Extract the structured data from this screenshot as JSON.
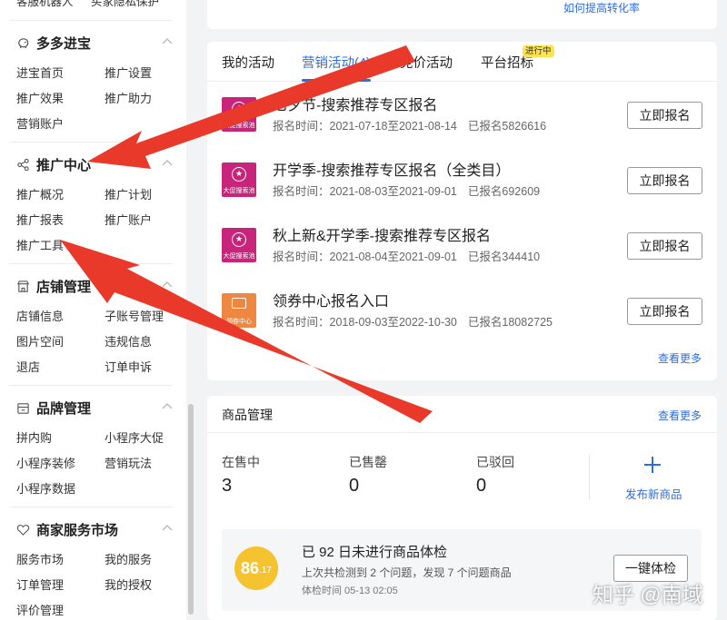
{
  "sidebar": {
    "top_items": [
      "客服机器人",
      "买家隐私保护"
    ],
    "groups": [
      {
        "title": "多多进宝",
        "icon": "pig-icon",
        "items": [
          "进宝首页",
          "推广设置",
          "推广效果",
          "推广助力",
          "营销账户"
        ]
      },
      {
        "title": "推广中心",
        "icon": "share-icon",
        "items": [
          "推广概况",
          "推广计划",
          "推广报表",
          "推广账户",
          "推广工具"
        ]
      },
      {
        "title": "店铺管理",
        "icon": "store-icon",
        "items": [
          "店铺信息",
          "子账号管理",
          "图片空间",
          "违规信息",
          "退店",
          "订单申诉"
        ]
      },
      {
        "title": "品牌管理",
        "icon": "brand-icon",
        "items": [
          "拼内购",
          "小程序大促",
          "小程序装修",
          "营销玩法",
          "小程序数据"
        ]
      },
      {
        "title": "商家服务市场",
        "icon": "heart-icon",
        "items": [
          "服务市场",
          "我的服务",
          "订单管理",
          "我的授权",
          "评价管理"
        ]
      }
    ]
  },
  "top_card": {
    "link": "如何提高转化率"
  },
  "activities": {
    "tabs": [
      "我的活动",
      "营销活动(4)",
      "竞价活动",
      "平台招标"
    ],
    "active_tab": 1,
    "badge": "进行中",
    "rows": [
      {
        "title": "七夕节-搜索推荐专区报名",
        "time": "报名时间：2021-07-18至2021-08-14",
        "count": "已报名5826616",
        "thumb_label": "大促搜索池",
        "button": "立即报名"
      },
      {
        "title": "开学季-搜索推荐专区报名（全类目）",
        "time": "报名时间：2021-08-03至2021-09-01",
        "count": "已报名692609",
        "thumb_label": "大促搜索池",
        "button": "立即报名"
      },
      {
        "title": "秋上新&开学季-搜索推荐专区报名",
        "time": "报名时间：2021-08-04至2021-09-01",
        "count": "已报名344410",
        "thumb_label": "大促搜索池",
        "button": "立即报名"
      },
      {
        "title": "领券中心报名入口",
        "time": "报名时间：2018-09-03至2022-10-30",
        "count": "已报名18082725",
        "thumb_label": "领券中心",
        "button": "立即报名"
      }
    ],
    "more": "查看更多"
  },
  "goods": {
    "title": "商品管理",
    "more": "查看更多",
    "stats": [
      {
        "label": "在售中",
        "value": "3"
      },
      {
        "label": "已售罄",
        "value": "0"
      },
      {
        "label": "已驳回",
        "value": "0"
      }
    ],
    "publish": "发布新商品",
    "health": {
      "score_int": "86",
      "score_dec": ".17",
      "title": "已 92 日未进行商品体检",
      "desc": "上次共检测到 2 个问题，发现 7 个问题商品",
      "time": "体检时间 05-13 02:05",
      "button": "一键体检"
    }
  },
  "watermark": "知乎 @南域",
  "colors": {
    "accent": "#2f6dde",
    "thumb_pink": "#c8247b",
    "thumb_orange": "#ee8742",
    "badge": "#fce34f",
    "score": "#f5c330",
    "arrow": "#e8392a"
  }
}
